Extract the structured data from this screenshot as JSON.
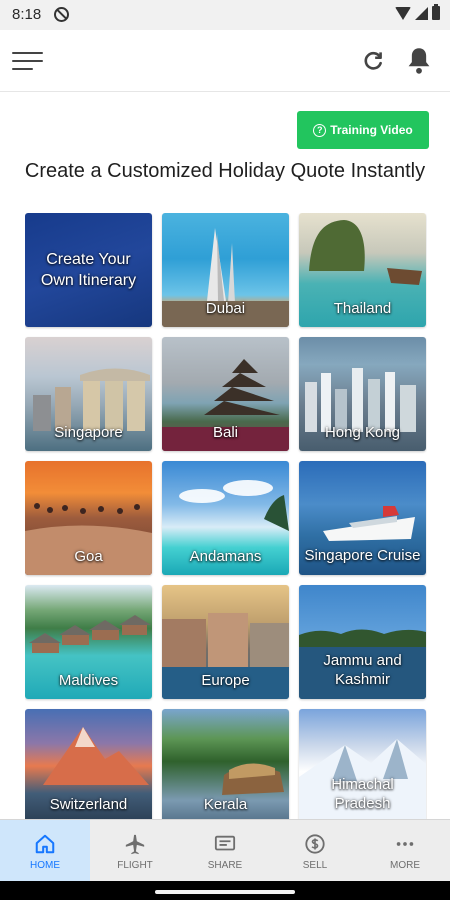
{
  "status_bar": {
    "time": "8:18"
  },
  "header": {
    "menu_icon": "hamburger-menu-icon",
    "refresh_icon": "refresh-icon",
    "notification_icon": "bell-icon"
  },
  "training_video": {
    "label": "Training Video",
    "icon": "help-circle-icon",
    "color": "#22c55e"
  },
  "page_title": "Create a Customized Holiday Quote Instantly",
  "destinations": [
    {
      "label": "Create Your Own Itinerary"
    },
    {
      "label": "Dubai"
    },
    {
      "label": "Thailand"
    },
    {
      "label": "Singapore"
    },
    {
      "label": "Bali"
    },
    {
      "label": "Hong Kong"
    },
    {
      "label": "Goa"
    },
    {
      "label": "Andamans"
    },
    {
      "label": "Singapore Cruise"
    },
    {
      "label": "Maldives"
    },
    {
      "label": "Europe"
    },
    {
      "label": "Jammu and Kashmir"
    },
    {
      "label": "Switzerland"
    },
    {
      "label": "Kerala"
    },
    {
      "label": "Himachal Pradesh"
    }
  ],
  "bottom_nav": {
    "items": [
      {
        "label": "HOME",
        "icon": "home-icon",
        "active": true
      },
      {
        "label": "FLIGHT",
        "icon": "airplane-icon",
        "active": false
      },
      {
        "label": "SHARE",
        "icon": "share-icon",
        "active": false
      },
      {
        "label": "SELL",
        "icon": "dollar-icon",
        "active": false
      },
      {
        "label": "MORE",
        "icon": "more-icon",
        "active": false
      }
    ],
    "active_color": "#1677ff"
  }
}
